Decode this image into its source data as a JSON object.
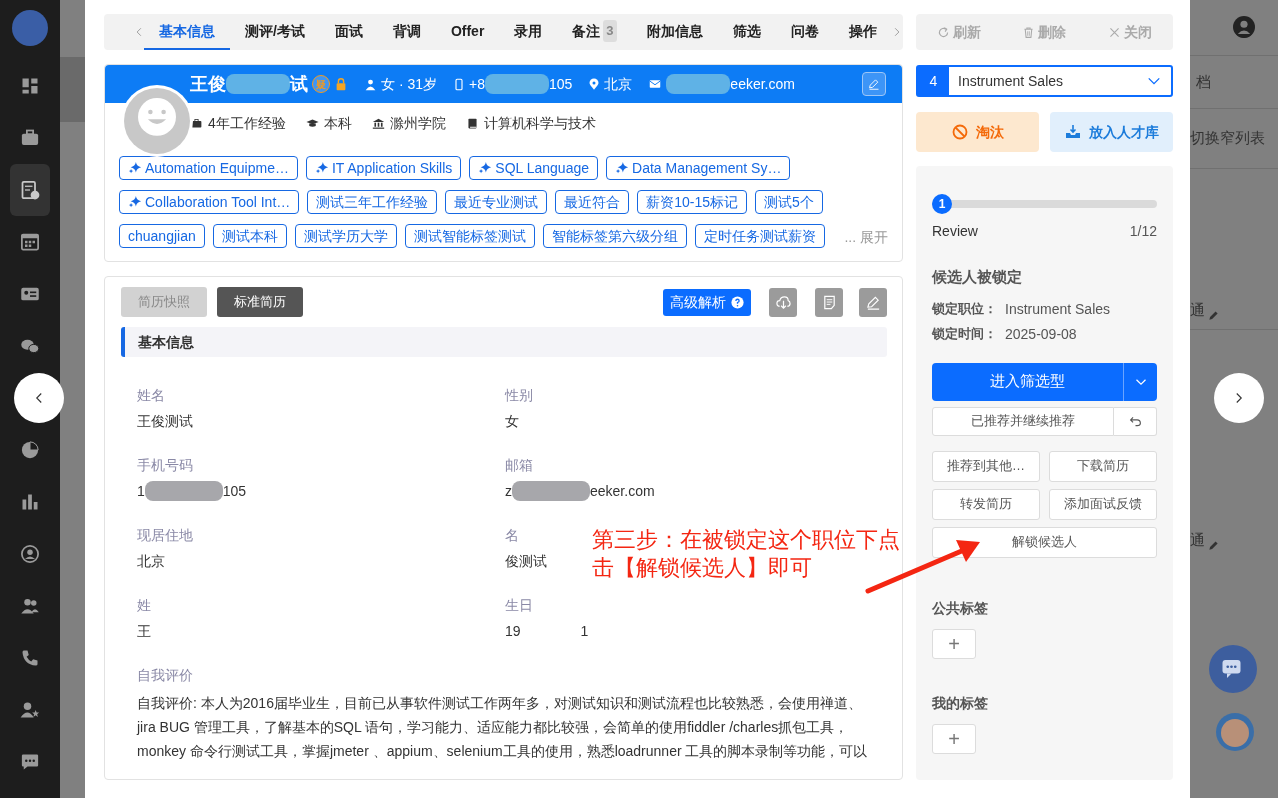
{
  "sidebar": {
    "items": [
      {
        "selected": false
      },
      {
        "selected": false
      },
      {
        "selected": true
      },
      {
        "selected": false
      },
      {
        "selected": false
      },
      {
        "selected": false
      },
      {
        "selected": false
      },
      {
        "selected": false
      },
      {
        "selected": false
      },
      {
        "selected": false
      },
      {
        "selected": false
      },
      {
        "selected": false
      },
      {
        "selected": false
      }
    ]
  },
  "background": {
    "texts": [
      "档",
      "切换窄列表",
      "通",
      "通"
    ]
  },
  "tabs": [
    {
      "label": "基本信息",
      "selected": true
    },
    {
      "label": "测评/考试",
      "selected": false
    },
    {
      "label": "面试",
      "selected": false
    },
    {
      "label": "背调",
      "selected": false
    },
    {
      "label": "Offer",
      "selected": false
    },
    {
      "label": "录用",
      "selected": false
    },
    {
      "label": "备注",
      "selected": false,
      "badge": "3"
    },
    {
      "label": "附加信息",
      "selected": false
    },
    {
      "label": "筛选",
      "selected": false
    },
    {
      "label": "问卷",
      "selected": false
    },
    {
      "label": "操作",
      "selected": false
    }
  ],
  "toolbar": [
    {
      "label": "刷新"
    },
    {
      "label": "删除"
    },
    {
      "label": "关闭"
    }
  ],
  "profile": {
    "name": [
      {
        "kind": "text",
        "text": "王俊"
      },
      {
        "kind": "redacted"
      },
      {
        "kind": "text",
        "text": "试"
      }
    ],
    "flag": "疑",
    "gender_age": "女 · 31岁",
    "phone": [
      {
        "kind": "text",
        "text": "+8"
      },
      {
        "kind": "redacted"
      },
      {
        "kind": "text",
        "text": "105"
      }
    ],
    "city": "北京",
    "email": [
      {
        "kind": "redacted"
      },
      {
        "kind": "text",
        "text": "eeker.com"
      }
    ],
    "details": [
      "4年工作经验",
      "本科",
      "滁州学院",
      "计算机科学与技术"
    ],
    "tags": [
      {
        "label": "Automation Equipme…",
        "ai": true
      },
      {
        "label": "IT Application Skills",
        "ai": true
      },
      {
        "label": "SQL Language",
        "ai": true
      },
      {
        "label": "Data Management Sy…",
        "ai": true
      },
      {
        "label": "Collaboration Tool Int…",
        "ai": true
      },
      {
        "label": "测试三年工作经验",
        "ai": false
      },
      {
        "label": "最近专业测试",
        "ai": false
      },
      {
        "label": "最近符合",
        "ai": false
      },
      {
        "label": "薪资10-15标记",
        "ai": false
      },
      {
        "label": "测试5个",
        "ai": false
      },
      {
        "label": "chuangjian",
        "ai": false
      },
      {
        "label": "测试本科",
        "ai": false
      },
      {
        "label": "测试学历大学",
        "ai": false
      },
      {
        "label": "测试智能标签测试",
        "ai": false
      },
      {
        "label": "智能标签第六级分组",
        "ai": false
      },
      {
        "label": "定时任务测试薪资",
        "ai": false
      }
    ],
    "expand": "... 展开"
  },
  "resume": {
    "views": [
      {
        "label": "简历快照",
        "selected": false
      },
      {
        "label": "标准简历",
        "selected": true
      }
    ],
    "parse_button": "高级解析",
    "section": "基本信息",
    "fields": [
      {
        "label": "姓名",
        "value": [
          {
            "kind": "text",
            "text": "王俊测试"
          }
        ]
      },
      {
        "label": "性别",
        "value": [
          {
            "kind": "text",
            "text": "女"
          }
        ]
      },
      {
        "label": "手机号码",
        "value": [
          {
            "kind": "text",
            "text": "1"
          },
          {
            "kind": "redacted"
          },
          {
            "kind": "text",
            "text": "105"
          }
        ]
      },
      {
        "label": "邮箱",
        "value": [
          {
            "kind": "text",
            "text": "z"
          },
          {
            "kind": "redacted"
          },
          {
            "kind": "text",
            "text": "eeker.com"
          }
        ]
      },
      {
        "label": "现居住地",
        "value": [
          {
            "kind": "text",
            "text": "北京"
          }
        ]
      },
      {
        "label": "名",
        "value": [
          {
            "kind": "text",
            "text": "俊测试"
          }
        ]
      },
      {
        "label": "姓",
        "value": [
          {
            "kind": "text",
            "text": "王"
          }
        ]
      },
      {
        "label": "生日",
        "value": [
          {
            "kind": "text",
            "text": "19"
          },
          {
            "kind": "blank"
          },
          {
            "kind": "text",
            "text": "1"
          }
        ]
      }
    ],
    "self_eval": {
      "label": "自我评价",
      "text": "自我评价: 本人为2016届毕业生，目前已从事软件测试工作两年多，对测试知识和测试流程也比较熟悉，会使用禅道、jira BUG 管理工具，了解基本的SQL 语句，学习能力、适应能力都比较强，会简单的使用fiddler /charles抓包工具，monkey 命令行测试工具，掌握jmeter 、appium、selenium工具的使用，熟悉loadrunner 工具的脚本录制等功能，可以"
    }
  },
  "job": {
    "count": "4",
    "title": "Instrument Sales"
  },
  "actions": {
    "reject": "淘汰",
    "pool": "放入人才库"
  },
  "pipeline": {
    "step": "1",
    "stage": "Review",
    "position": "1/12",
    "status": "候选人被锁定",
    "lock": [
      {
        "label": "锁定职位：",
        "value": "Instrument Sales"
      },
      {
        "label": "锁定时间：",
        "value": "2025-09-08"
      }
    ],
    "primary": "进入筛选型",
    "recommend": "已推荐并继续推荐",
    "buttons": [
      "推荐到其他…",
      "下载简历",
      "转发简历",
      "添加面试反馈",
      "解锁候选人"
    ]
  },
  "tag_groups": [
    {
      "title": "公共标签",
      "add": "+"
    },
    {
      "title": "我的标签",
      "add": "+"
    }
  ],
  "annotation": "第三步：在被锁定这个职位下点击【解锁候选人】即可"
}
